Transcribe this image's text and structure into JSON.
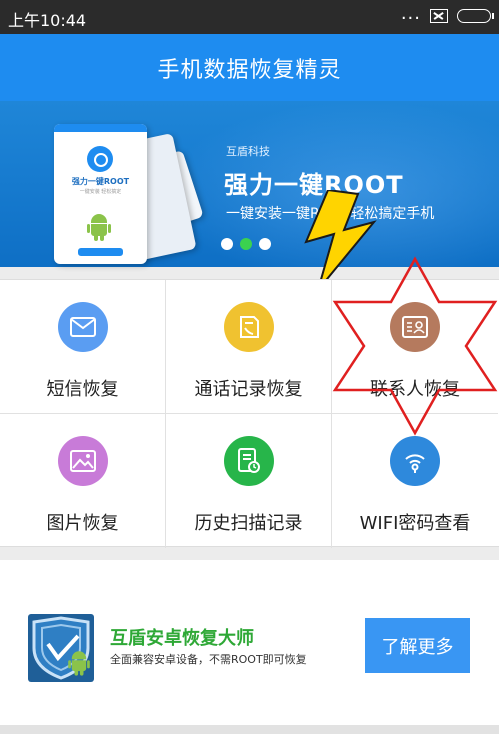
{
  "status_bar": {
    "time": "上午10:44",
    "dots": "..."
  },
  "title_bar": {
    "title": "手机数据恢复精灵"
  },
  "banner": {
    "phone_text": "强力一键ROOT",
    "phone_sub": "一键安装 轻松搞定",
    "brand": "互盾科技",
    "headline": "强力一键ROOT",
    "tagline": "一键安装一键ROOT轻松搞定手机",
    "slide_count": 3,
    "active_slide": 2
  },
  "grid": {
    "items": [
      {
        "label": "短信恢复",
        "icon": "message-icon"
      },
      {
        "label": "通话记录恢复",
        "icon": "call-log-icon"
      },
      {
        "label": "联系人恢复",
        "icon": "contact-card-icon"
      },
      {
        "label": "图片恢复",
        "icon": "picture-icon"
      },
      {
        "label": "历史扫描记录",
        "icon": "history-document-icon"
      },
      {
        "label": "WIFI密码查看",
        "icon": "wifi-icon"
      }
    ]
  },
  "promo": {
    "title": "互盾安卓恢复大师",
    "description": "全面兼容安卓设备，不需ROOT即可恢复",
    "button": "了解更多"
  },
  "colors": {
    "title_bar": "#1e8cf0",
    "banner": "#0e6fc5",
    "annotation_red": "#e02020",
    "bolt_yellow": "#ffd400",
    "promo_green": "#2ea836",
    "promo_button": "#3996f3"
  }
}
